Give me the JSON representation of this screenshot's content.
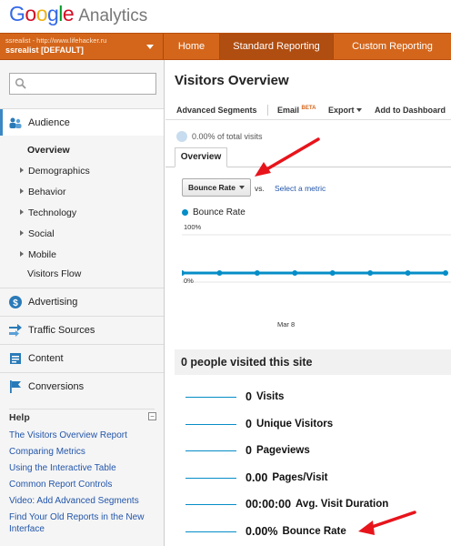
{
  "header": {
    "logo_google": "Google",
    "logo_analytics": "Analytics",
    "account_url": "ssrealist - http://www.lifehacker.ru",
    "account_profile": "ssrealist [DEFAULT]",
    "tabs": [
      {
        "label": "Home",
        "active": false
      },
      {
        "label": "Standard Reporting",
        "active": true
      },
      {
        "label": "Custom Reporting",
        "active": false
      }
    ]
  },
  "sidebar": {
    "search_placeholder": "",
    "sections": [
      {
        "label": "Audience",
        "icon": "people-icon",
        "active": true
      },
      {
        "label": "Advertising",
        "icon": "dollar-icon"
      },
      {
        "label": "Traffic Sources",
        "icon": "arrows-icon"
      },
      {
        "label": "Content",
        "icon": "page-icon"
      },
      {
        "label": "Conversions",
        "icon": "flag-icon"
      }
    ],
    "audience_items": [
      {
        "label": "Overview",
        "selected": true
      },
      {
        "label": "Demographics"
      },
      {
        "label": "Behavior"
      },
      {
        "label": "Technology"
      },
      {
        "label": "Social"
      },
      {
        "label": "Mobile"
      },
      {
        "label": "Visitors Flow"
      }
    ],
    "help_title": "Help",
    "help_links": [
      "The Visitors Overview Report",
      "Comparing Metrics",
      "Using the Interactive Table",
      "Common Report Controls",
      "Video: Add Advanced Segments",
      "Find Your Old Reports in the New Interface"
    ]
  },
  "main": {
    "title": "Visitors Overview",
    "toolbar": {
      "advanced_segments": "Advanced Segments",
      "email": "Email",
      "email_badge": "BETA",
      "export": "Export",
      "add_to_dashboard": "Add to Dashboard"
    },
    "total_visits_text": "0.00% of total visits",
    "subtab": "Overview",
    "metric_select": "Bounce Rate",
    "vs_text": "vs.",
    "select_metric": "Select a metric",
    "legend": "Bounce Rate",
    "chart_ticks": {
      "top": "100%",
      "bottom": "0%",
      "x": "Mar 8"
    },
    "visited_text": "0 people visited this site",
    "stats": [
      {
        "value": "0",
        "label": "Visits"
      },
      {
        "value": "0",
        "label": "Unique Visitors"
      },
      {
        "value": "0",
        "label": "Pageviews"
      },
      {
        "value": "0.00",
        "label": "Pages/Visit"
      },
      {
        "value": "00:00:00",
        "label": "Avg. Visit Duration"
      },
      {
        "value": "0.00%",
        "label": "Bounce Rate"
      }
    ]
  },
  "colors": {
    "brand_orange": "#d4661b",
    "series_blue": "#058dc7",
    "annotation_red": "#e8141b"
  },
  "chart_data": {
    "type": "line",
    "series": [
      {
        "name": "Bounce Rate",
        "values": [
          0,
          0,
          0,
          0,
          0,
          0,
          0,
          0
        ]
      }
    ],
    "x_tick_labels": [
      "Mar 8"
    ],
    "y_tick_labels": [
      "100%",
      "0%"
    ],
    "ylim": [
      0,
      100
    ]
  }
}
